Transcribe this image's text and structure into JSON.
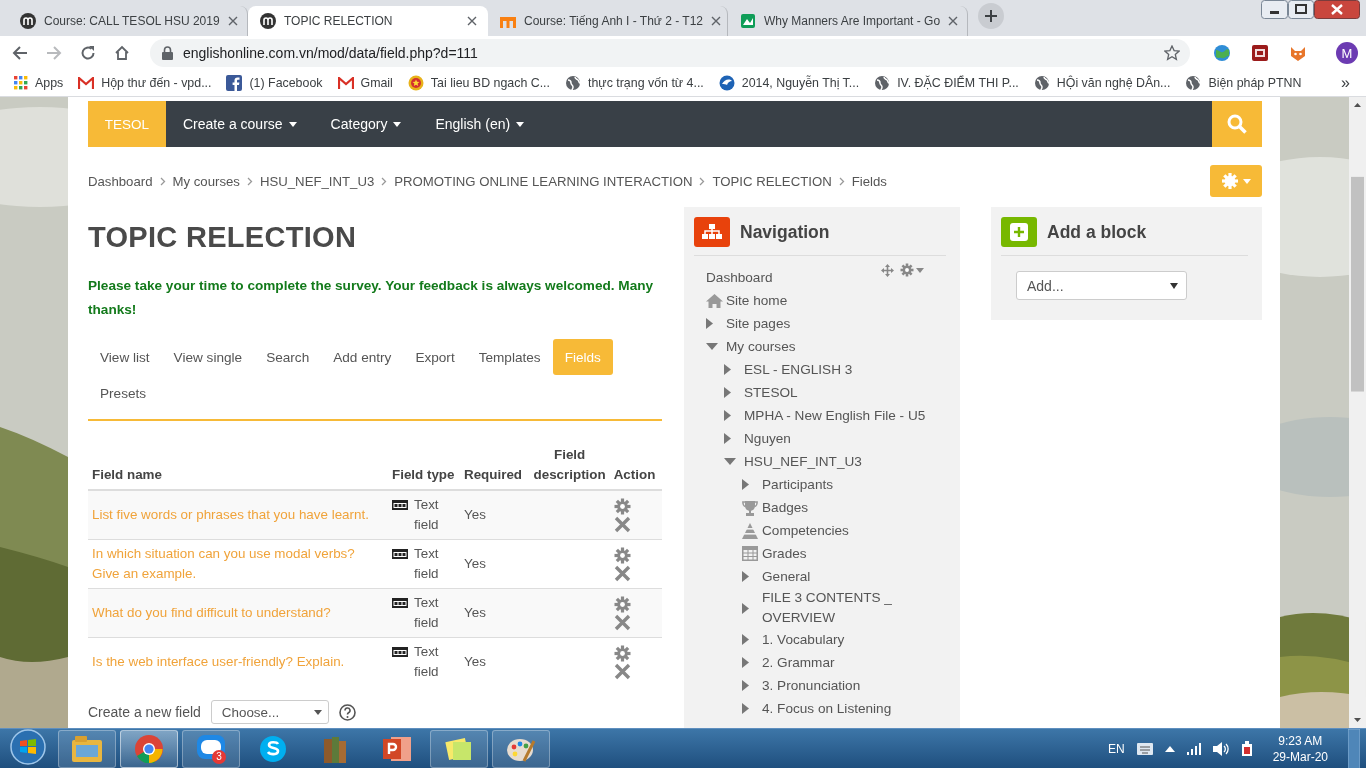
{
  "browser": {
    "tabs": [
      {
        "title": "Course: CALL TESOL HSU 2019",
        "selected": false,
        "kind": "moodle"
      },
      {
        "title": "TOPIC RELECTION",
        "selected": true,
        "kind": "moodle"
      },
      {
        "title": "Course: Tiếng Anh I - Thứ 2 - T12",
        "selected": false,
        "kind": "moodle-orange"
      },
      {
        "title": "Why Manners Are Important - Go",
        "selected": false,
        "kind": "slides"
      }
    ],
    "url": "englishonline.com.vn/mod/data/field.php?d=111",
    "profile_initial": "M",
    "bookmarks": [
      {
        "label": "Apps",
        "kind": "apps"
      },
      {
        "label": "Hộp thư đến - vpd...",
        "kind": "gmail"
      },
      {
        "label": "(1) Facebook",
        "kind": "facebook"
      },
      {
        "label": "Gmail",
        "kind": "gmail"
      },
      {
        "label": "Tai lieu BD ngach C...",
        "kind": "emblem"
      },
      {
        "label": "thực trạng vốn từ 4...",
        "kind": "globe"
      },
      {
        "label": "2014, Nguyễn Thị T...",
        "kind": "blue"
      },
      {
        "label": "IV. ĐẶC ĐIỂM THI P...",
        "kind": "globe"
      },
      {
        "label": "HỘi văn nghệ DÂn...",
        "kind": "globe"
      },
      {
        "label": "Biện pháp PTNN",
        "kind": "globe"
      }
    ],
    "more": "»"
  },
  "navbar": {
    "brand": "TESOL",
    "menus": [
      "Create a course",
      "Category",
      "English (en)"
    ]
  },
  "breadcrumb": [
    "Dashboard",
    "My courses",
    "HSU_NEF_INT_U3",
    "PROMOTING ONLINE LEARNING INTERACTION",
    "TOPIC RELECTION",
    "Fields"
  ],
  "heading": "TOPIC RELECTION",
  "intro": "Please take your time to complete the survey. Your feedback is always welcomed. Many thanks!",
  "tabs": [
    {
      "label": "View list",
      "selected": false
    },
    {
      "label": "View single",
      "selected": false
    },
    {
      "label": "Search",
      "selected": false
    },
    {
      "label": "Add entry",
      "selected": false
    },
    {
      "label": "Export",
      "selected": false
    },
    {
      "label": "Templates",
      "selected": false
    },
    {
      "label": "Fields",
      "selected": true
    },
    {
      "label": "Presets",
      "selected": false
    }
  ],
  "table": {
    "columns": [
      "Field name",
      "Field type",
      "Required",
      "Field description",
      "Action"
    ],
    "rows": [
      {
        "name": "List five words or phrases that you have learnt.",
        "type": "Text field",
        "required": "Yes"
      },
      {
        "name": "In which situation can you use modal verbs? Give an example.",
        "type": "Text field",
        "required": "Yes"
      },
      {
        "name": "What do you find difficult to understand?",
        "type": "Text field",
        "required": "Yes"
      },
      {
        "name": "Is the web interface user-friendly? Explain.",
        "type": "Text field",
        "required": "Yes"
      }
    ]
  },
  "create_field": {
    "label": "Create a new field",
    "value": "Choose..."
  },
  "navigation": {
    "title": "Navigation",
    "items": [
      {
        "label": "Dashboard",
        "kind": "text"
      },
      {
        "label": "Site home",
        "kind": "home"
      },
      {
        "label": "Site pages",
        "kind": "branch",
        "expanded": false
      },
      {
        "label": "My courses",
        "kind": "branch",
        "expanded": true,
        "children": [
          {
            "label": "ESL - ENGLISH 3",
            "kind": "branch",
            "expanded": false
          },
          {
            "label": "STESOL",
            "kind": "branch",
            "expanded": false
          },
          {
            "label": "MPHA - New English File - U5",
            "kind": "branch",
            "expanded": false
          },
          {
            "label": "Nguyen",
            "kind": "branch",
            "expanded": false
          },
          {
            "label": "HSU_NEF_INT_U3",
            "kind": "branch",
            "expanded": true,
            "children": [
              {
                "label": "Participants",
                "kind": "branch",
                "expanded": false
              },
              {
                "label": "Badges",
                "kind": "trophy"
              },
              {
                "label": "Competencies",
                "kind": "competency"
              },
              {
                "label": "Grades",
                "kind": "grades"
              },
              {
                "label": "General",
                "kind": "branch",
                "expanded": false
              },
              {
                "label": "FILE 3 CONTENTS _ OVERVIEW",
                "kind": "branch",
                "expanded": false
              },
              {
                "label": "1. Vocabulary",
                "kind": "branch",
                "expanded": false
              },
              {
                "label": "2. Grammar",
                "kind": "branch",
                "expanded": false
              },
              {
                "label": "3. Pronunciation",
                "kind": "branch",
                "expanded": false
              },
              {
                "label": "4. Focus on Listening",
                "kind": "branch",
                "expanded": false
              }
            ]
          }
        ]
      }
    ]
  },
  "add_block": {
    "title": "Add a block",
    "value": "Add..."
  },
  "taskbar": {
    "apps": [
      {
        "kind": "explorer",
        "active": false
      },
      {
        "kind": "chrome",
        "active": true
      },
      {
        "kind": "zalo",
        "active": false,
        "badge": "3"
      },
      {
        "kind": "skype",
        "active": false
      },
      {
        "kind": "books",
        "active": false
      },
      {
        "kind": "powerpoint",
        "active": false
      },
      {
        "kind": "notes",
        "active": false
      },
      {
        "kind": "paint",
        "active": false
      }
    ],
    "language": "EN",
    "time": "9:23 AM",
    "date": "29-Mar-20"
  }
}
